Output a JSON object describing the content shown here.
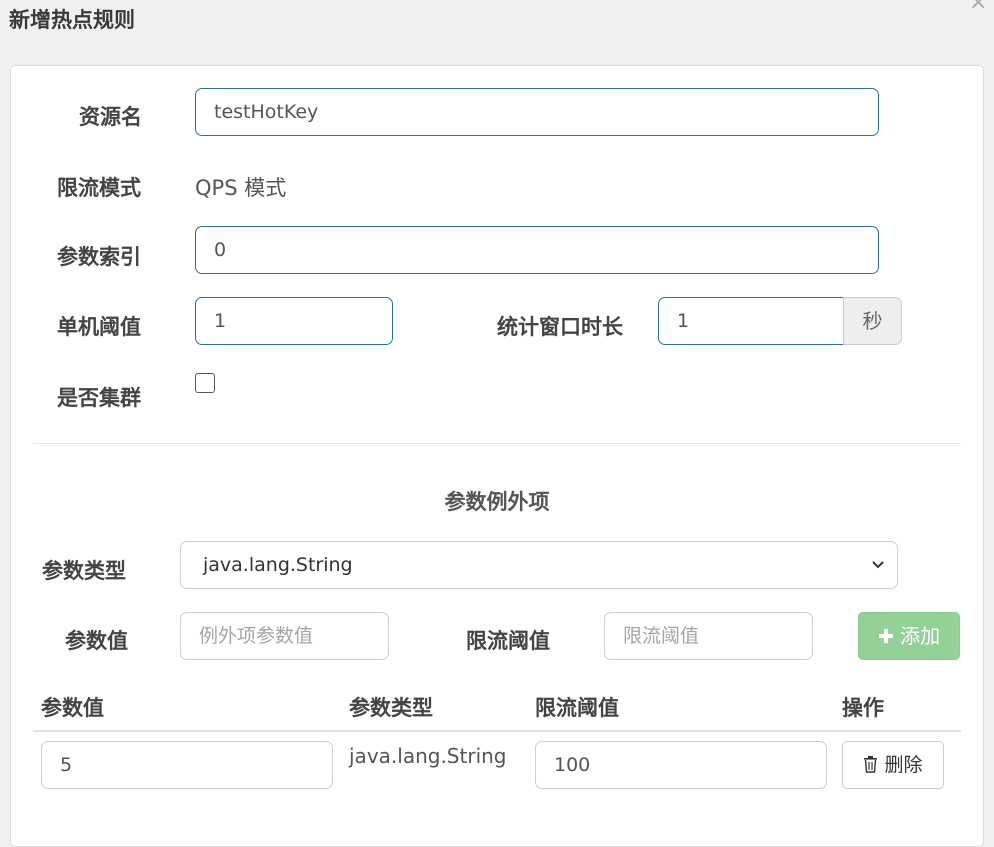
{
  "dialog": {
    "title": "新增热点规则",
    "close_label": "×"
  },
  "form": {
    "resource_label": "资源名",
    "resource_value": "testHotKey",
    "mode_label": "限流模式",
    "mode_value": "QPS 模式",
    "param_index_label": "参数索引",
    "param_index_value": "0",
    "threshold_label": "单机阈值",
    "threshold_value": "1",
    "window_label": "统计窗口时长",
    "window_value": "1",
    "window_unit": "秒",
    "cluster_label": "是否集群",
    "cluster_checked": false
  },
  "exceptions": {
    "section_title": "参数例外项",
    "type_label": "参数类型",
    "type_selected": "java.lang.String",
    "value_label": "参数值",
    "value_placeholder": "例外项参数值",
    "limit_label": "限流阈值",
    "limit_placeholder": "限流阈值",
    "add_label": "添加",
    "table": {
      "headers": [
        "参数值",
        "参数类型",
        "限流阈值",
        "操作"
      ],
      "rows": [
        {
          "value": "5",
          "type": "java.lang.String",
          "limit": "100",
          "action": "删除"
        }
      ]
    }
  },
  "colors": {
    "accent": "#2e6da4",
    "add_button": "#93d197"
  }
}
